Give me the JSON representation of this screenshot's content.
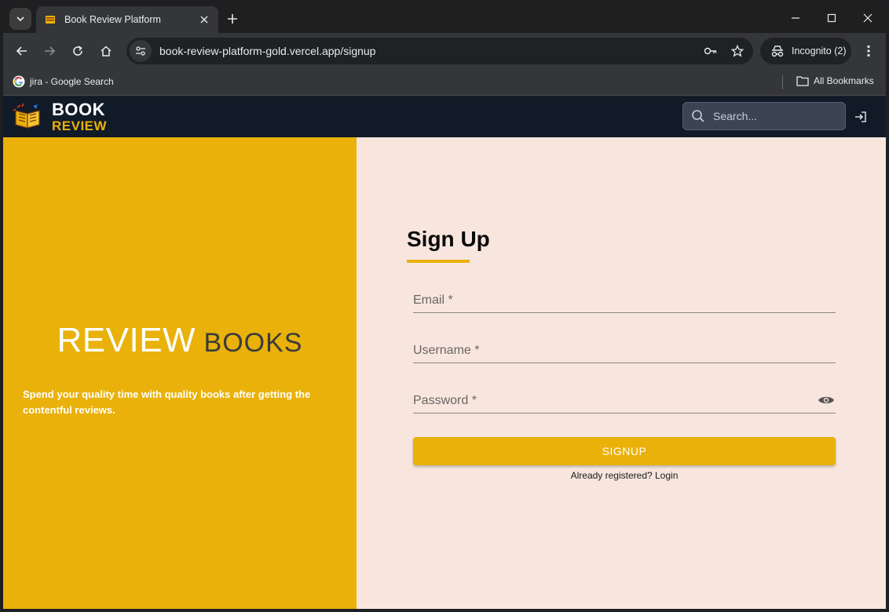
{
  "browser": {
    "tab_title": "Book Review Platform",
    "url": "book-review-platform-gold.vercel.app/signup",
    "incognito_label": "Incognito (2)",
    "bookmark_label": "jira - Google Search",
    "all_bookmarks_label": "All Bookmarks"
  },
  "header": {
    "logo_line1": "BOOK",
    "logo_line2": "REVIEW",
    "search_placeholder": "Search..."
  },
  "hero": {
    "title_main": "REVIEW",
    "title_sub": "BOOKS",
    "description": "Spend your quality time with quality books after getting the contentful reviews."
  },
  "form": {
    "title": "Sign Up",
    "email_label": "Email *",
    "username_label": "Username *",
    "password_label": "Password *",
    "submit_label": "SIGNUP",
    "login_prompt": "Already registered? Login"
  },
  "colors": {
    "accent": "#e9b10a",
    "header_bg": "#111a27",
    "page_bg": "#f8e6de"
  }
}
